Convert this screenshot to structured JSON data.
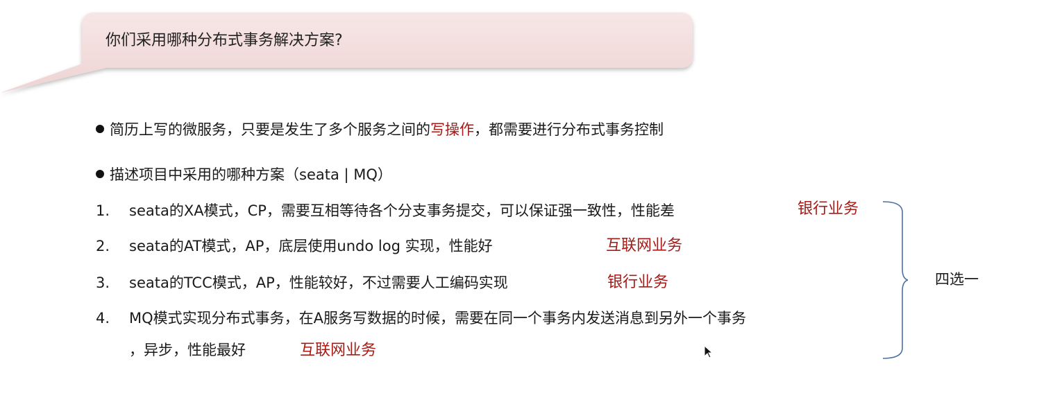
{
  "question": "你们采用哪种分布式事务解决方案?",
  "bullet1": {
    "before": "简历上写的微服务，只要是发生了多个服务之间的",
    "highlight": "写操作",
    "after": "，都需要进行分布式事务控制"
  },
  "bullet2": "描述项目中采用的哪种方案（seata | MQ）",
  "items": [
    {
      "num": "1.",
      "text": "seata的XA模式，CP，需要互相等待各个分支事务提交，可以保证强一致性，性能差",
      "tag": "银行业务"
    },
    {
      "num": "2.",
      "text": "seata的AT模式，AP，底层使用undo log 实现，性能好",
      "tag": "互联网业务"
    },
    {
      "num": "3.",
      "text": "seata的TCC模式，AP，性能较好，不过需要人工编码实现",
      "tag": "银行业务"
    },
    {
      "num": "4.",
      "text": "MQ模式实现分布式事务，在A服务写数据的时候，需要在同一个事务内发送消息到另外一个事务",
      "text2": "，异步，性能最好",
      "tag": "互联网业务"
    }
  ],
  "brace_label": "四选一",
  "colors": {
    "highlight": "#a61b16",
    "bubble": "#f3dcdc"
  }
}
